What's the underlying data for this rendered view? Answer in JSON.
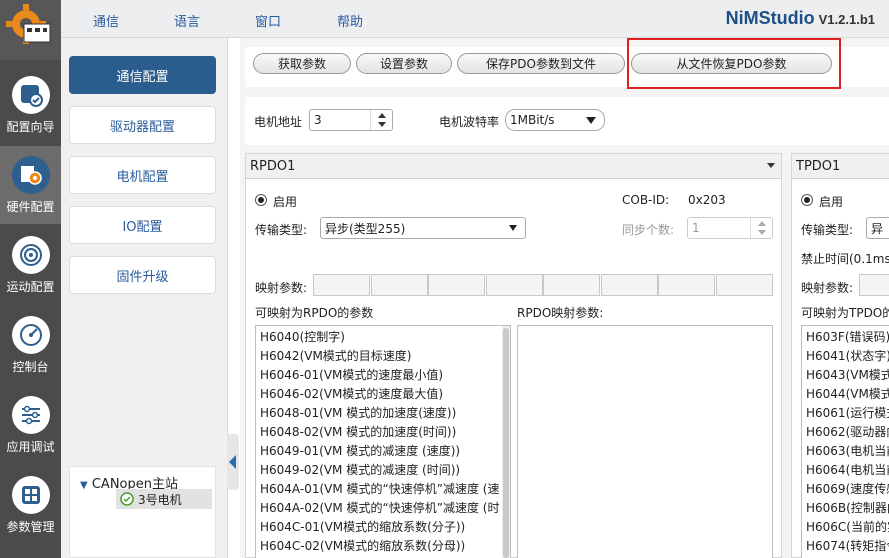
{
  "menu": {
    "items": [
      "通信",
      "语言",
      "窗口",
      "帮助"
    ]
  },
  "brand": {
    "name": "NiMStudio",
    "version": "V1.2.1.b1"
  },
  "rail": {
    "items": [
      {
        "label": "配置向导",
        "icon": "wizard-icon"
      },
      {
        "label": "硬件配置",
        "icon": "hardware-icon",
        "active": true
      },
      {
        "label": "运动配置",
        "icon": "motion-icon"
      },
      {
        "label": "控制台",
        "icon": "gauge-icon"
      },
      {
        "label": "应用调试",
        "icon": "sliders-icon"
      },
      {
        "label": "参数管理",
        "icon": "params-icon"
      }
    ]
  },
  "nav": {
    "items": [
      "通信配置",
      "驱动器配置",
      "电机配置",
      "IO配置",
      "固件升级"
    ],
    "active_index": 0
  },
  "tree": {
    "root": "CANopen主站",
    "child": "3号电机"
  },
  "toolbar": {
    "get_params": "获取参数",
    "set_params": "设置参数",
    "save_pdo": "保存PDO参数到文件",
    "restore_pdo": "从文件恢复PDO参数"
  },
  "settings": {
    "motor_address_label": "电机地址",
    "motor_address_value": "3",
    "baud_label": "电机波特率",
    "baud_value": "1MBit/s"
  },
  "rpdo": {
    "title": "RPDO1",
    "enable_label": "启用",
    "cob_id_label": "COB-ID:",
    "cob_id_value": "0x203",
    "transfer_label": "传输类型:",
    "transfer_value": "异步(类型255)",
    "sync_count_label": "同步个数:",
    "sync_count_value": "1",
    "map_label": "映射参数:",
    "available_label": "可映射为RPDO的参数",
    "mapped_label": "RPDO映射参数:",
    "available_params": [
      "H6040(控制字)",
      "H6042(VM模式的目标速度)",
      "H6046-01(VM模式的速度最小值)",
      "H6046-02(VM模式的速度最大值)",
      "H6048-01(VM 模式的加速度(速度))",
      "H6048-02(VM 模式的加速度(时间))",
      "H6049-01(VM 模式的减速度 (速度))",
      "H6049-02(VM 模式的减速度 (时间))",
      "H604A-01(VM 模式的“快速停机”减速度 (速",
      "H604A-02(VM 模式的“快速停机”减速度 (时",
      "H604C-01(VM模式的缩放系数(分子))",
      "H604C-02(VM模式的缩放系数(分母))"
    ]
  },
  "tpdo": {
    "title": "TPDO1",
    "enable_label": "启用",
    "transfer_label": "传输类型:",
    "transfer_value": "异",
    "inhibit_label": "禁止时间(0.1ms)",
    "map_label": "映射参数:",
    "available_label": "可映射为TPDO的",
    "available_params": [
      "H603F(错误码)",
      "H6041(状态字)",
      "H6043(VM模式",
      "H6044(VM模式",
      "H6061(运行模式",
      "H6062(驱动器内",
      "H6063(电机当前",
      "H6064(电机当前",
      "H6069(速度传感",
      "H606B(控制器内",
      "H606C(当前的实",
      "H6074(转矩指令"
    ]
  }
}
